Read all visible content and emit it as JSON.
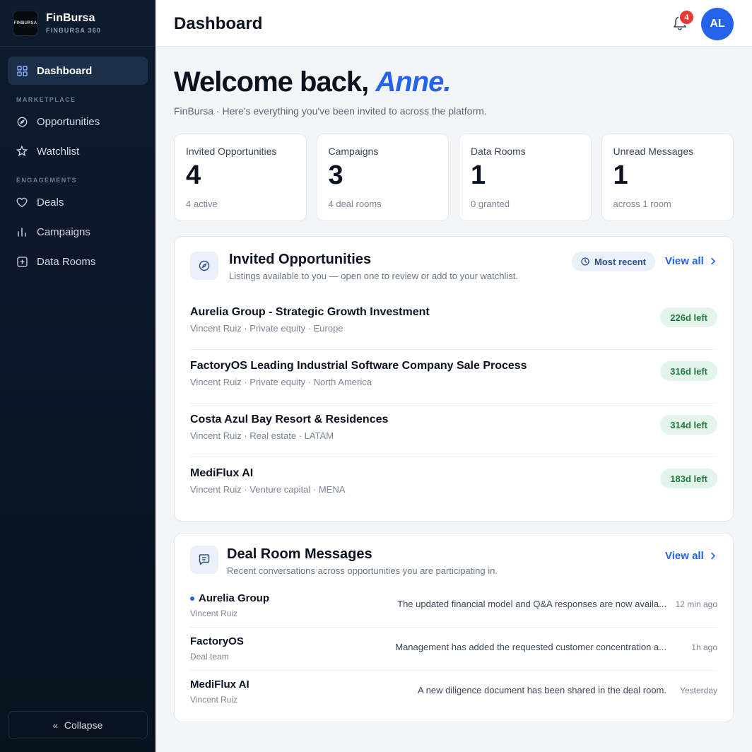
{
  "brand": {
    "logo_text": "FINBURSA",
    "name": "FinBursa",
    "sub": "FINBURSA 360"
  },
  "sidebar": {
    "dashboard": "Dashboard",
    "section_marketplace": "MARKETPLACE",
    "opportunities": "Opportunities",
    "watchlist": "Watchlist",
    "section_engagements": "ENGAGEMENTS",
    "deals": "Deals",
    "campaigns": "Campaigns",
    "data_rooms": "Data Rooms",
    "collapse": "Collapse"
  },
  "topbar": {
    "title": "Dashboard",
    "notifications_count": "4",
    "avatar_initials": "AL"
  },
  "welcome": {
    "prefix": "Welcome back, ",
    "name": "Anne.",
    "subtitle": "FinBursa · Here's everything you've been invited to across the platform."
  },
  "stats": [
    {
      "label": "Invited Opportunities",
      "value": "4",
      "sub": "4 active"
    },
    {
      "label": "Campaigns",
      "value": "3",
      "sub": "4 deal rooms"
    },
    {
      "label": "Data Rooms",
      "value": "1",
      "sub": "0 granted"
    },
    {
      "label": "Unread Messages",
      "value": "1",
      "sub": "across 1 room"
    }
  ],
  "opportunities": {
    "title": "Invited Opportunities",
    "subtitle": "Listings available to you — open one to review or add to your watchlist.",
    "chip": "Most recent",
    "view_all": "View all",
    "items": [
      {
        "title": "Aurelia Group - Strategic Growth Investment",
        "meta": "Vincent Ruiz · Private equity · Europe",
        "badge": "226d left"
      },
      {
        "title": "FactoryOS Leading Industrial Software Company Sale Process",
        "meta": "Vincent Ruiz · Private equity · North America",
        "badge": "316d left"
      },
      {
        "title": "Costa Azul Bay Resort & Residences",
        "meta": "Vincent Ruiz · Real estate · LATAM",
        "badge": "314d left"
      },
      {
        "title": "MediFlux AI",
        "meta": "Vincent Ruiz · Venture capital · MENA",
        "badge": "183d left"
      }
    ]
  },
  "messages": {
    "title": "Deal Room Messages",
    "subtitle": "Recent conversations across opportunities you are participating in.",
    "view_all": "View all",
    "items": [
      {
        "title": "Aurelia Group",
        "from": "Vincent Ruiz",
        "text": "The updated financial model and Q&A responses are now availa...",
        "time": "12 min ago",
        "unread": true
      },
      {
        "title": "FactoryOS",
        "from": "Deal team",
        "text": "Management has added the requested customer concentration a...",
        "time": "1h ago",
        "unread": false
      },
      {
        "title": "MediFlux AI",
        "from": "Vincent Ruiz",
        "text": "A new diligence document has been shared in the deal room.",
        "time": "Yesterday",
        "unread": false
      }
    ]
  },
  "colors": {
    "accent": "#2563eb",
    "sidebar_bg": "#0e1b2e",
    "badge_red": "#e53935",
    "success_bg": "#e3f5ea",
    "success_text": "#1f7a43"
  }
}
